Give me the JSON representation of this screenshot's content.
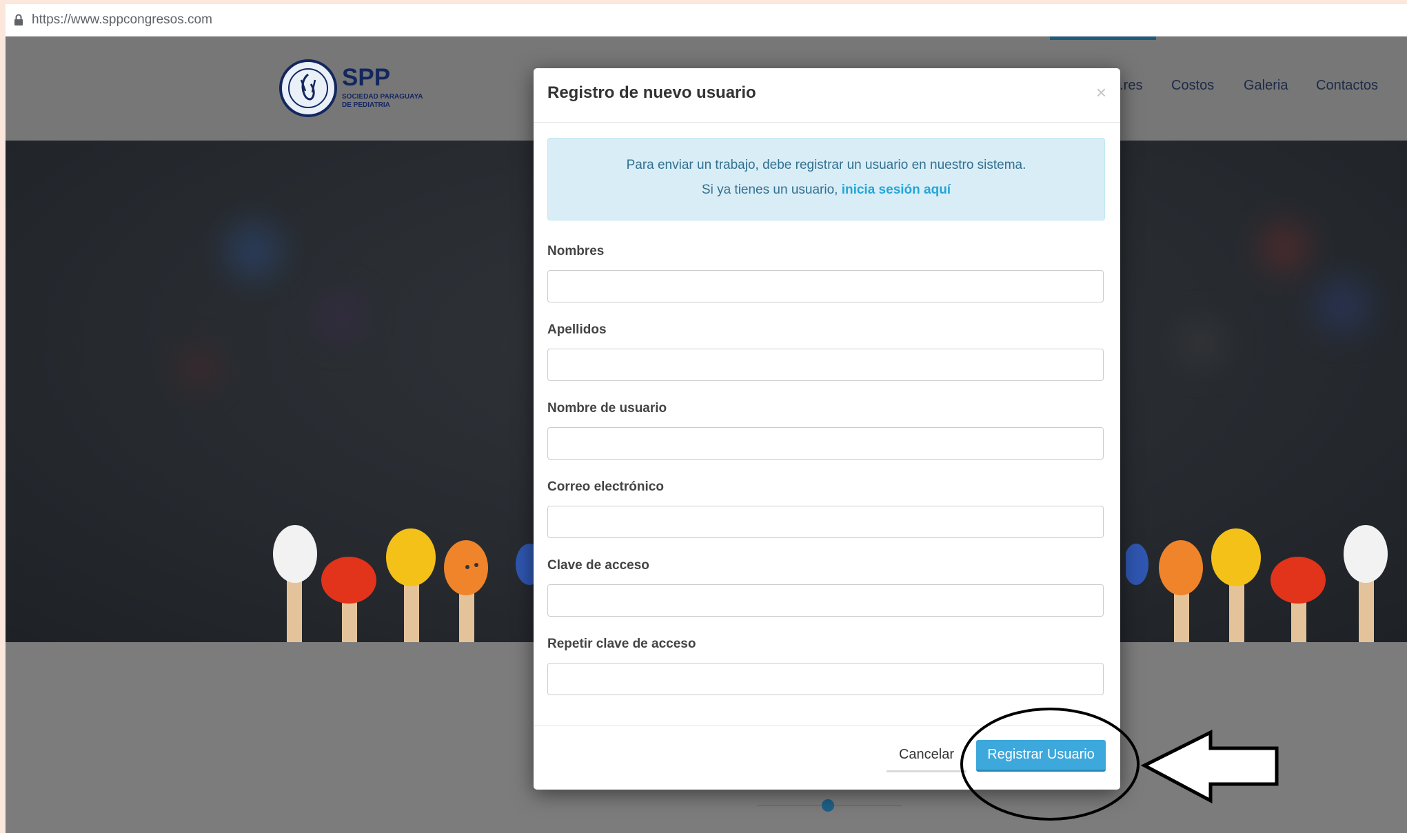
{
  "browser": {
    "url": "https://www.sppcongresos.com"
  },
  "site": {
    "logo_title": "SPP",
    "logo_subtitle": "SOCIEDAD PARAGUAYA\nDE PEDIATRIA",
    "nav": [
      "...res",
      "Costos",
      "Galeria",
      "Contactos"
    ]
  },
  "modal": {
    "title": "Registro de nuevo usuario",
    "close": "×",
    "info_line1": "Para enviar un trabajo, debe registrar un usuario en nuestro sistema.",
    "info_line2_prefix": "Si ya tienes un usuario, ",
    "info_link": "inicia sesión aquí",
    "fields": [
      {
        "label": "Nombres",
        "value": ""
      },
      {
        "label": "Apellidos",
        "value": ""
      },
      {
        "label": "Nombre de usuario",
        "value": ""
      },
      {
        "label": "Correo electrónico",
        "value": ""
      },
      {
        "label": "Clave de acceso",
        "value": ""
      },
      {
        "label": "Repetir clave de acceso",
        "value": ""
      }
    ],
    "cancel_label": "Cancelar",
    "submit_label": "Registrar Usuario"
  },
  "colors": {
    "accent": "#3da8dc",
    "info_bg": "#d9edf7",
    "brand": "#13265e"
  }
}
